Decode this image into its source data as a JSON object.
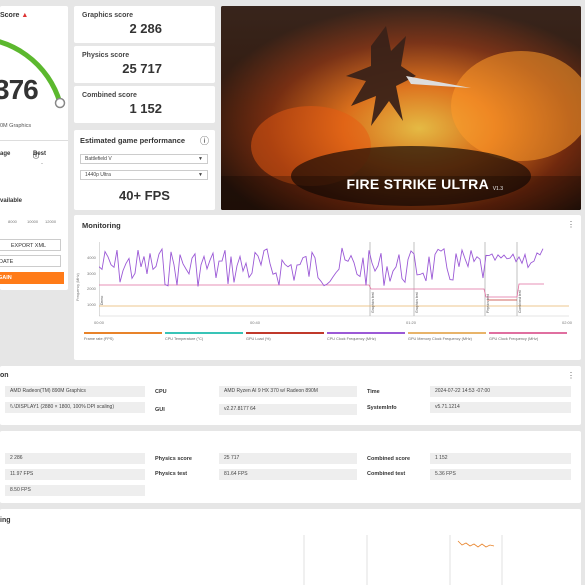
{
  "left_panel": {
    "title": "Score",
    "score": "376",
    "gpu": "0M Graphics",
    "col_average": "age",
    "col_best": "Best",
    "best_value": "-",
    "availability": "vailable",
    "axis_ticks": [
      "8000",
      "10000",
      "12000"
    ],
    "export_label": "EXPORT XML",
    "update_label": "DATE",
    "run_again_label": "GAIN",
    "accent": "#ff7b18",
    "gauge_color": "#5cb82e"
  },
  "scores": [
    {
      "label": "Graphics score",
      "value": "2 286"
    },
    {
      "label": "Physics score",
      "value": "25 717"
    },
    {
      "label": "Combined score",
      "value": "1 152"
    }
  ],
  "game_perf": {
    "title": "Estimated game performance",
    "game": "Battlefield V",
    "resolution": "1440p Ultra",
    "fps": "40+ FPS"
  },
  "banner": {
    "title": "FIRE STRIKE ULTRA",
    "version": "V1.3"
  },
  "monitoring": {
    "title": "Monitoring",
    "y_axis_label": "Frequency (MHz)",
    "y_ticks": [
      "4000",
      "3000",
      "2000",
      "1000"
    ],
    "x_ticks": [
      "00:00",
      "00:40",
      "01:20",
      "02:00"
    ],
    "markers": [
      "Demo",
      "Graphics test",
      "Graphics test",
      "Physics test",
      "Combined test"
    ],
    "legend": [
      {
        "label": "Frame rate (FPS)",
        "color": "#e8832a"
      },
      {
        "label": "CPU Temperature (°C)",
        "color": "#39c4b7"
      },
      {
        "label": "GPU Load (%)",
        "color": "#c0392b"
      },
      {
        "label": "CPU Clock Frequency (MHz)",
        "color": "#9b59d6"
      },
      {
        "label": "GPU Memory Clock Frequency (MHz)",
        "color": "#e8b46a"
      },
      {
        "label": "GPU Clock Frequency (MHz)",
        "color": "#e06fa0"
      }
    ]
  },
  "system_info": {
    "title": "on",
    "gpu": "AMD Radeon(TM) 890M Graphics",
    "display": "\\\\.\\DISPLAY1 (2880 × 1800, 100% DPI scaling)",
    "cpu_label": "CPU",
    "cpu": "AMD Ryzen AI 9 HX 370 w/ Radeon 890M",
    "gui_label": "GUI",
    "gui": "v2.27.8177 64",
    "time_label": "Time",
    "time": "2024-07-22 14:53 -07:00",
    "sysinfo_label": "SystemInfo",
    "sysinfo": "v5.71.1214"
  },
  "detailed_scores": {
    "graphics_score": "2 286",
    "graphics_test_1": "11.97 FPS",
    "graphics_test_2": "8.50 FPS",
    "physics_score_label": "Physics score",
    "physics_score": "25 717",
    "physics_test_label": "Physics test",
    "physics_test": "81.64 FPS",
    "combined_score_label": "Combined score",
    "combined_score": "1 152",
    "combined_test_label": "Combined test",
    "combined_test": "5.36 FPS"
  },
  "bottom_section": {
    "title": "ing"
  }
}
